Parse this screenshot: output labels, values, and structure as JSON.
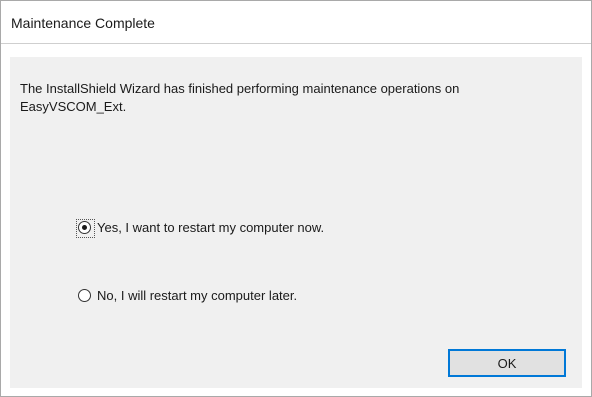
{
  "window": {
    "title": "Maintenance Complete"
  },
  "dialog": {
    "message": "The InstallShield Wizard has finished performing maintenance operations on EasyVSCOM_Ext.",
    "options": [
      {
        "label": "Yes, I want to restart my computer now.",
        "checked": true
      },
      {
        "label": "No, I will restart my computer later.",
        "checked": false
      }
    ],
    "ok_label": "OK"
  },
  "colors": {
    "accent": "#0078d7",
    "panel_bg": "#f0f0f0"
  }
}
